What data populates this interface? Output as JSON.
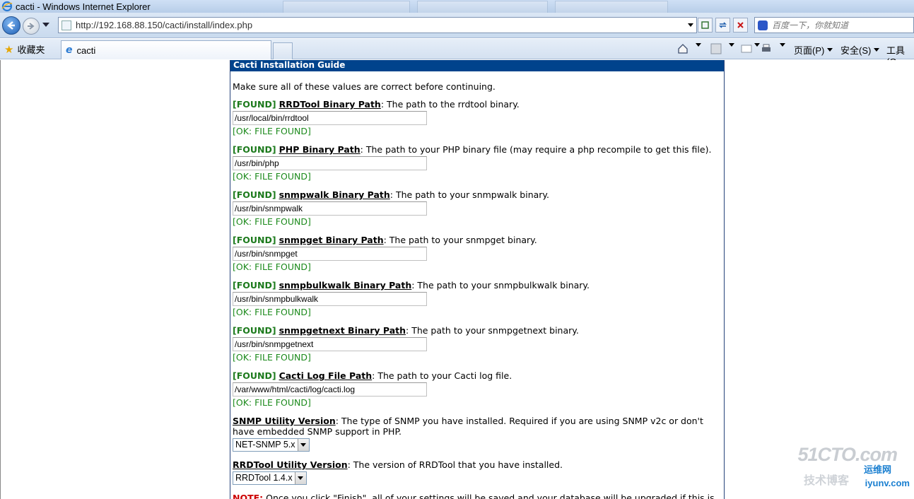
{
  "window": {
    "title": "cacti - Windows Internet Explorer"
  },
  "address_bar": {
    "url": "http://192.168.88.150/cacti/install/index.php"
  },
  "search_box": {
    "placeholder": "百度一下，你就知道"
  },
  "favorites": {
    "label": "收藏夹"
  },
  "tabs": [
    {
      "label": "cacti",
      "active": true
    }
  ],
  "command_bar": {
    "page_menu": "页面(P)",
    "safety_menu": "安全(S)",
    "tools_menu": "工具(O"
  },
  "guide": {
    "header": "Cacti Installation Guide",
    "intro": "Make sure all of these values are correct before continuing.",
    "found_tag": "[FOUND]",
    "ok_tag": "[OK: FILE FOUND]",
    "items": [
      {
        "label": "RRDTool Binary Path",
        "desc": ": The path to the rrdtool binary.",
        "value": "/usr/local/bin/rrdtool"
      },
      {
        "label": "PHP Binary Path",
        "desc": ": The path to your PHP binary file (may require a php recompile to get this file).",
        "value": "/usr/bin/php"
      },
      {
        "label": "snmpwalk Binary Path",
        "desc": ": The path to your snmpwalk binary.",
        "value": "/usr/bin/snmpwalk"
      },
      {
        "label": "snmpget Binary Path",
        "desc": ": The path to your snmpget binary.",
        "value": "/usr/bin/snmpget"
      },
      {
        "label": "snmpbulkwalk Binary Path",
        "desc": ": The path to your snmpbulkwalk binary.",
        "value": "/usr/bin/snmpbulkwalk"
      },
      {
        "label": "snmpgetnext Binary Path",
        "desc": ": The path to your snmpgetnext binary.",
        "value": "/usr/bin/snmpgetnext"
      },
      {
        "label": "Cacti Log File Path",
        "desc": ": The path to your Cacti log file.",
        "value": "/var/www/html/cacti/log/cacti.log"
      }
    ],
    "snmp_version": {
      "label": "SNMP Utility Version",
      "desc": ": The type of SNMP you have installed. Required if you are using SNMP v2c or don't have embedded SNMP support in PHP.",
      "selected": "NET-SNMP 5.x"
    },
    "rrdtool_version": {
      "label": "RRDTool Utility Version",
      "desc": ": The version of RRDTool that you have installed.",
      "selected": "RRDTool 1.4.x"
    },
    "note": {
      "label": "NOTE:",
      "text": " Once you click \"Finish\", all of your settings will be saved and your database will be upgraded if this is"
    }
  },
  "watermark": {
    "line1": "51CTO.com",
    "line2": "技术博客",
    "line3": "iyunv.com",
    "line4": "运维网"
  },
  "colors": {
    "header_bg": "#00438c",
    "found_green": "#1c7a1c",
    "note_red": "#cc0000"
  }
}
